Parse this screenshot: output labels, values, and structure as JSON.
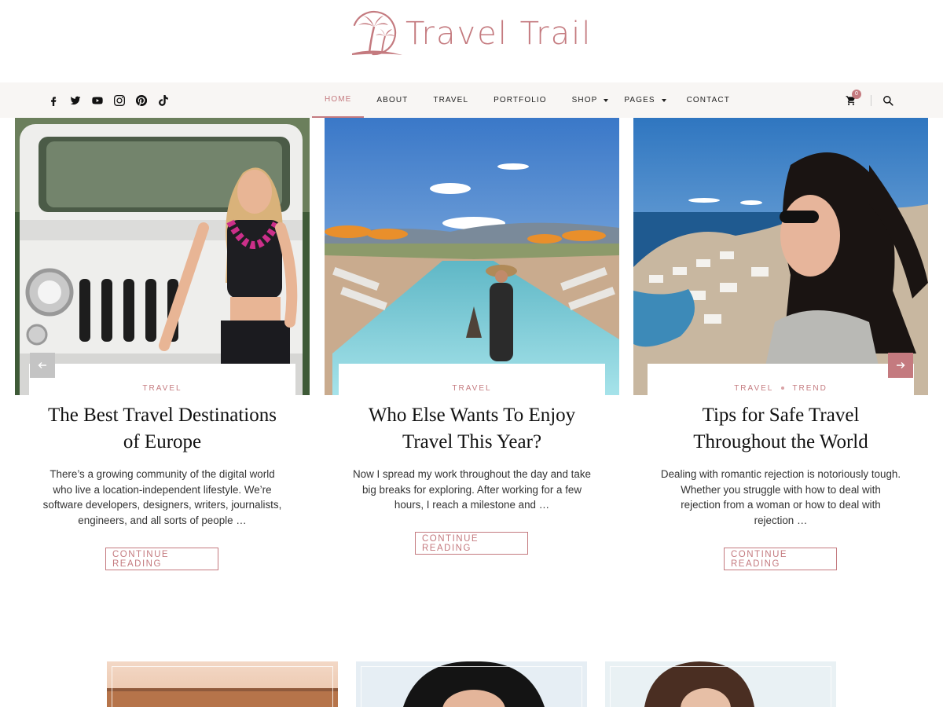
{
  "site": {
    "logo_text": "Travel Trail"
  },
  "social": [
    {
      "icon": "facebook-icon"
    },
    {
      "icon": "twitter-icon"
    },
    {
      "icon": "youtube-icon"
    },
    {
      "icon": "instagram-icon"
    },
    {
      "icon": "pinterest-icon"
    },
    {
      "icon": "tiktok-icon"
    }
  ],
  "nav": {
    "items": [
      {
        "label": "HOME",
        "active": true
      },
      {
        "label": "ABOUT"
      },
      {
        "label": "TRAVEL"
      },
      {
        "label": "PORTFOLIO"
      },
      {
        "label": "SHOP",
        "has_submenu": true
      },
      {
        "label": "PAGES",
        "has_submenu": true
      },
      {
        "label": "CONTACT"
      }
    ],
    "cart_count": "0"
  },
  "slider": {
    "cards": [
      {
        "categories": [
          "TRAVEL"
        ],
        "title": "The Best Travel Destinations of Europe",
        "excerpt": "There’s a growing community of the digital world who live a location-independent lifestyle. We’re software developers, designers, writers, journalists, engineers, and all sorts of people …",
        "button": "CONTINUE READING"
      },
      {
        "categories": [
          "TRAVEL"
        ],
        "title": "Who Else Wants To Enjoy Travel This Year?",
        "excerpt": "Now I spread my work throughout the day and take big breaks for exploring. After working for a few hours, I reach a milestone and …",
        "button": "CONTINUE READING"
      },
      {
        "categories": [
          "TRAVEL",
          "TREND"
        ],
        "title": "Tips for Safe Travel Throughout the World",
        "excerpt": "Dealing with romantic rejection is notoriously tough. Whether you struggle with how to deal with rejection from a woman or how to deal with rejection …",
        "button": "CONTINUE READING"
      }
    ]
  },
  "colors": {
    "accent": "#c47a7f",
    "nav_bg": "#f8f6f4"
  }
}
